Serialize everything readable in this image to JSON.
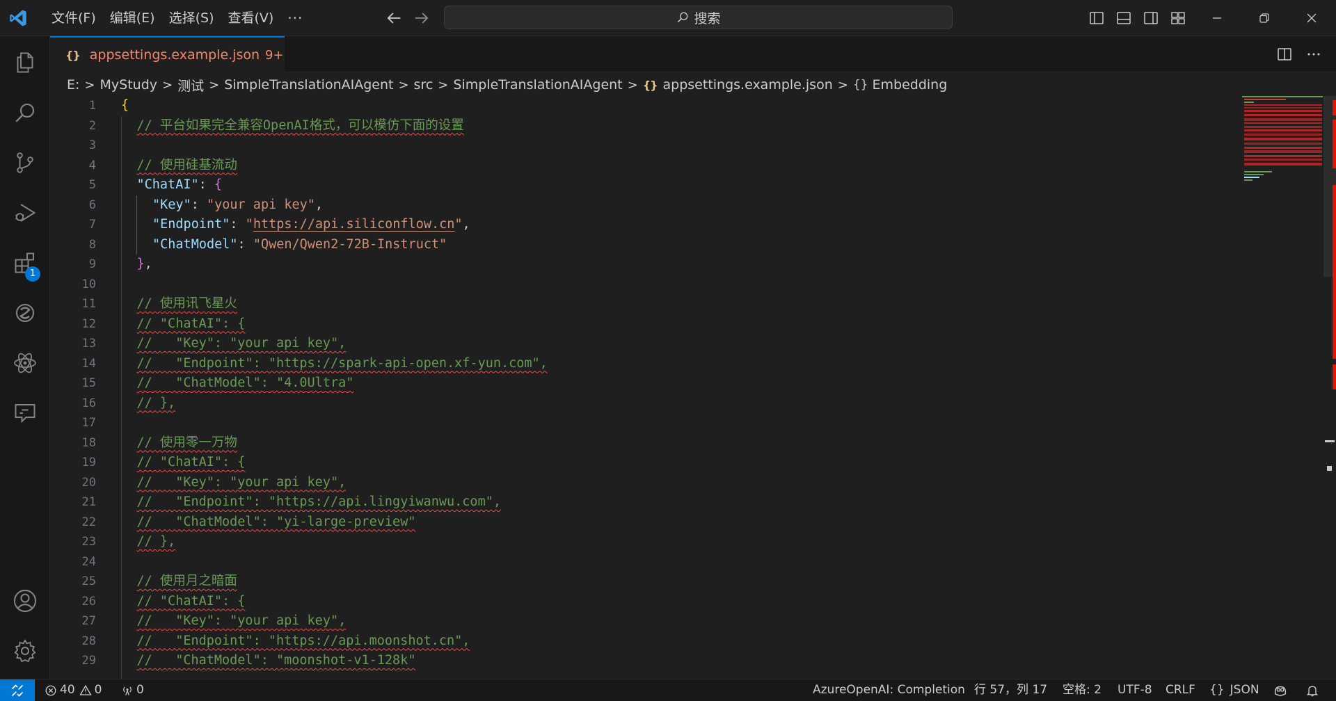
{
  "titlebar": {
    "menus": [
      "文件(F)",
      "编辑(E)",
      "选择(S)",
      "查看(V)"
    ],
    "more_label": "···",
    "search_label": "搜索"
  },
  "activitybar": {
    "items": [
      "explorer-icon",
      "search-icon",
      "source-control-icon",
      "run-debug-icon",
      "extensions-icon",
      "gitlens-icon",
      "react-icon",
      "chat-icon"
    ],
    "extensions_badge": "1",
    "bottom": [
      "accounts-icon",
      "settings-gear-icon"
    ]
  },
  "tab": {
    "filename": "appsettings.example.json",
    "problem_count": "9+"
  },
  "breadcrumb": {
    "items": [
      "E:",
      "MyStudy",
      "测试",
      "SimpleTranslationAIAgent",
      "src",
      "SimpleTranslationAIAgent",
      "appsettings.example.json",
      "Embedding"
    ]
  },
  "editor": {
    "line_numbers": [
      "1",
      "2",
      "3",
      "4",
      "5",
      "6",
      "7",
      "8",
      "9",
      "10",
      "11",
      "12",
      "13",
      "14",
      "15",
      "16",
      "17",
      "18",
      "19",
      "20",
      "21",
      "22",
      "23",
      "24",
      "25",
      "26",
      "27",
      "28",
      "29"
    ],
    "lines": [
      {
        "b1": "{"
      },
      {
        "c": "// 平台如果完全兼容OpenAI格式，可以模仿下面的设置"
      },
      {},
      {
        "c": "// 使用硅基流动"
      },
      {
        "k": "\"ChatAI\"",
        "p": ": ",
        "b2": "{"
      },
      {
        "k": "\"Key\"",
        "p": ": ",
        "s": "\"your api key\"",
        "p2": ","
      },
      {
        "k": "\"Endpoint\"",
        "p": ": ",
        "s": "\"",
        "u": "https://api.siliconflow.cn",
        "s2": "\"",
        "p2": ","
      },
      {
        "k": "\"ChatModel\"",
        "p": ": ",
        "s": "\"Qwen/Qwen2-72B-Instruct\""
      },
      {
        "b2": "}",
        "p2": ","
      },
      {},
      {
        "c": "// 使用讯飞星火"
      },
      {
        "c": "// \"ChatAI\": {"
      },
      {
        "c": "//   \"Key\": \"your api key\","
      },
      {
        "c": "//   \"Endpoint\": \"https://spark-api-open.xf-yun.com\","
      },
      {
        "c": "//   \"ChatModel\": \"4.0Ultra\""
      },
      {
        "c": "// },"
      },
      {},
      {
        "c": "// 使用零一万物"
      },
      {
        "c": "// \"ChatAI\": {"
      },
      {
        "c": "//   \"Key\": \"your api key\","
      },
      {
        "c": "//   \"Endpoint\": \"https://api.lingyiwanwu.com\","
      },
      {
        "c": "//   \"ChatModel\": \"yi-large-preview\""
      },
      {
        "c": "// },"
      },
      {},
      {
        "c": "// 使用月之暗面"
      },
      {
        "c": "// \"ChatAI\": {"
      },
      {
        "c": "//   \"Key\": \"your api key\","
      },
      {
        "c": "//   \"Endpoint\": \"https://api.moonshot.cn\","
      },
      {
        "c": "//   \"ChatModel\": \"moonshot-v1-128k\""
      }
    ]
  },
  "statusbar": {
    "errors": "40",
    "warnings": "0",
    "ports": "0",
    "azure": "AzureOpenAI: Completion",
    "position": "行 57，列 17",
    "spaces": "空格: 2",
    "encoding": "UTF-8",
    "eol": "CRLF",
    "language": "JSON"
  },
  "colors": {
    "accent": "#0078d4",
    "comment": "#6a9955",
    "key": "#9cdcfe",
    "string": "#ce9178",
    "error": "#f14c4c",
    "tab_modified": "#f48771"
  }
}
